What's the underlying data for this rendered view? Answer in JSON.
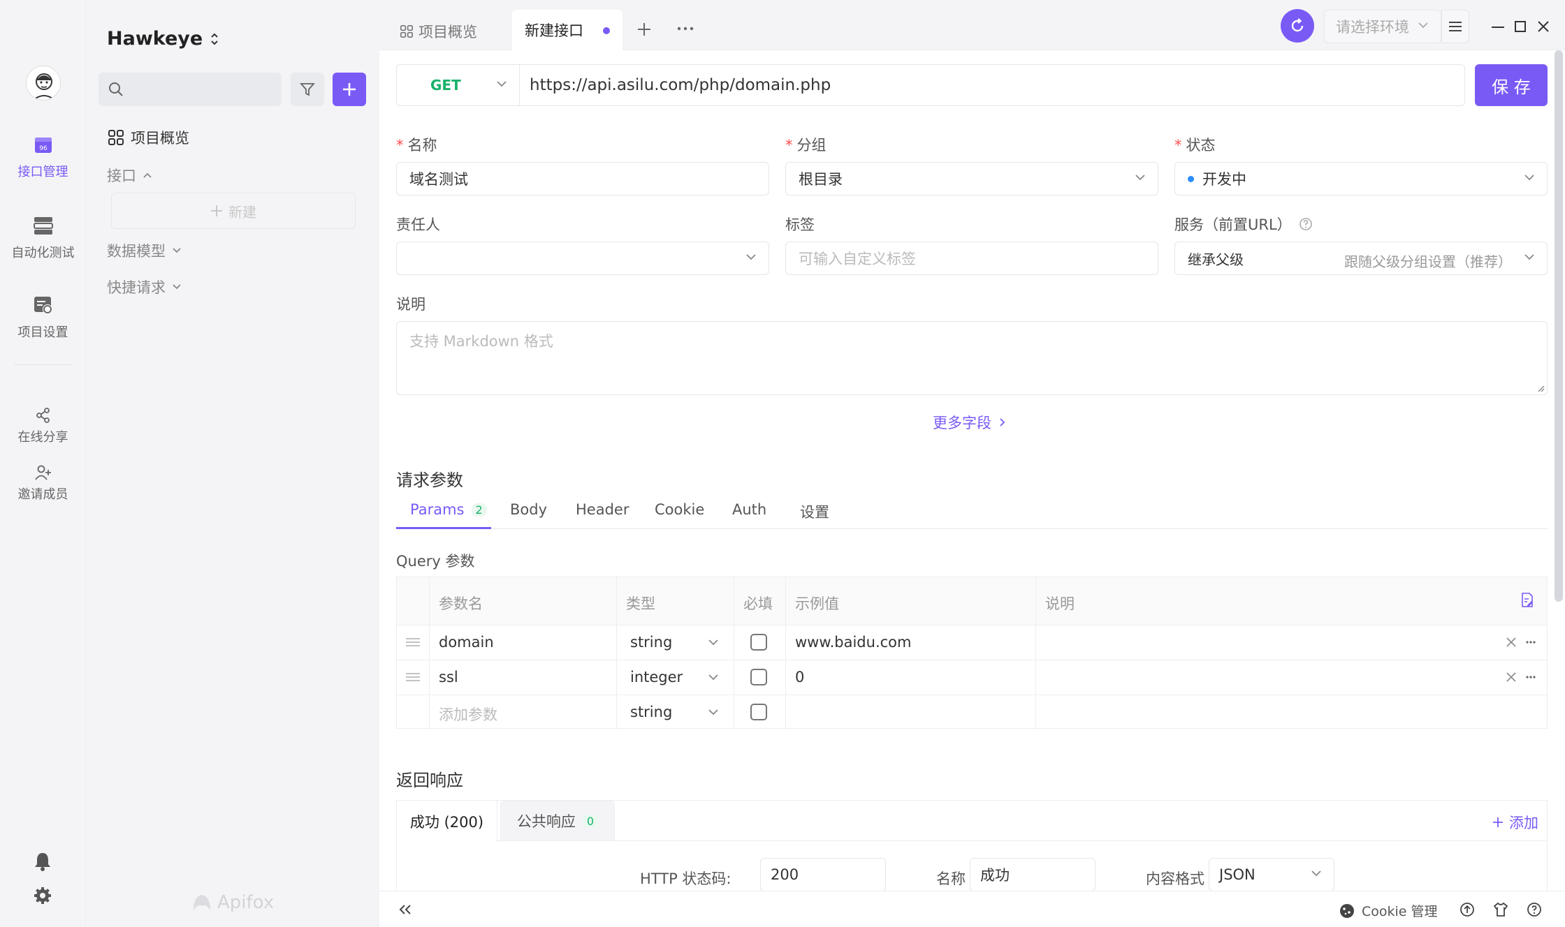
{
  "rail": {
    "items": [
      {
        "label": "接口管理",
        "icon": "api-management-icon",
        "active": true
      },
      {
        "label": "自动化测试",
        "icon": "automation-test-icon",
        "active": false
      },
      {
        "label": "项目设置",
        "icon": "project-settings-icon",
        "active": false
      },
      {
        "label": "在线分享",
        "icon": "share-icon",
        "active": false
      },
      {
        "label": "邀请成员",
        "icon": "invite-member-icon",
        "active": false
      }
    ]
  },
  "tree": {
    "project_name": "Hawkeye",
    "overview_label": "项目概览",
    "api_section": "接口",
    "new_label": "新建",
    "data_model": "数据模型",
    "quick_request": "快捷请求",
    "brand": "Apifox"
  },
  "tabs": {
    "overview": "项目概览",
    "current": "新建接口",
    "env_placeholder": "请选择环境"
  },
  "request": {
    "method": "GET",
    "url": "https://api.asilu.com/php/domain.php",
    "save_label": "保 存"
  },
  "form": {
    "name_label": "名称",
    "name_value": "域名测试",
    "group_label": "分组",
    "group_value": "根目录",
    "status_label": "状态",
    "status_value": "开发中",
    "owner_label": "责任人",
    "tag_label": "标签",
    "tag_placeholder": "可输入自定义标签",
    "service_label": "服务（前置URL）",
    "service_value": "继承父级",
    "service_hint": "跟随父级分组设置（推荐）",
    "desc_label": "说明",
    "desc_placeholder": "支持 Markdown 格式",
    "more_fields": "更多字段"
  },
  "params": {
    "section_title": "请求参数",
    "tabs": [
      {
        "label": "Params",
        "badge": "2"
      },
      {
        "label": "Body"
      },
      {
        "label": "Header"
      },
      {
        "label": "Cookie"
      },
      {
        "label": "Auth"
      },
      {
        "label": "设置"
      }
    ],
    "query_title": "Query 参数",
    "columns": [
      "参数名",
      "类型",
      "必填",
      "示例值",
      "说明"
    ],
    "rows": [
      {
        "name": "domain",
        "type": "string",
        "example": "www.baidu.com"
      },
      {
        "name": "ssl",
        "type": "integer",
        "example": "0"
      }
    ],
    "add_placeholder": "添加参数",
    "add_type": "string"
  },
  "response": {
    "section_title": "返回响应",
    "tab_success": "成功 (200)",
    "tab_common": "公共响应",
    "tab_common_badge": "0",
    "add_label": "添加",
    "http_status_label": "HTTP 状态码:",
    "http_status_value": "200",
    "name_label": "名称",
    "name_value": "成功",
    "content_type_label": "内容格式",
    "content_type_value": "JSON"
  },
  "footer": {
    "cookie_label": "Cookie 管理"
  },
  "colors": {
    "accent": "#7a5af5",
    "get_method": "#17b26a",
    "status_dot": "#2b8cff"
  }
}
